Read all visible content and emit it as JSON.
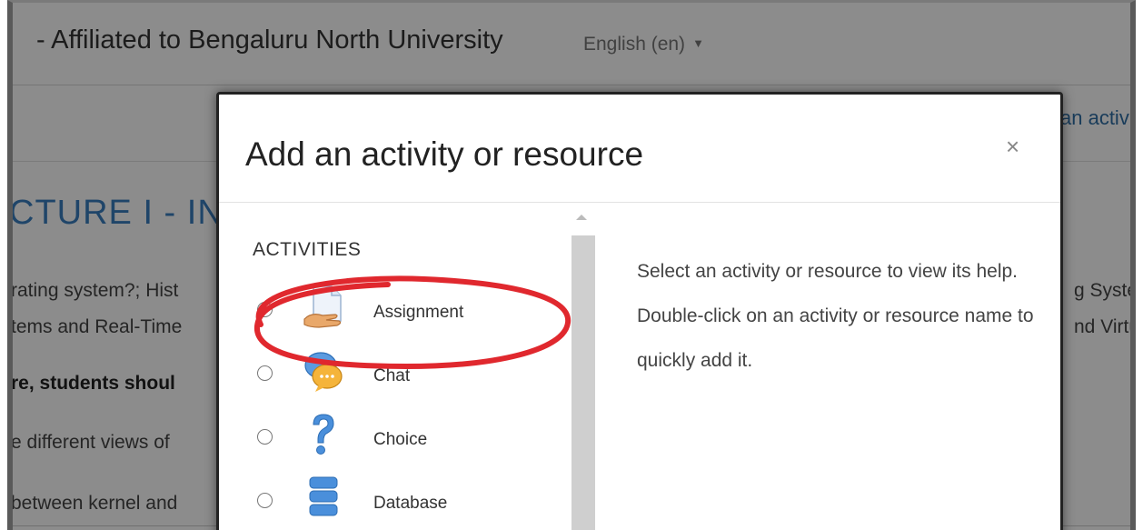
{
  "header": {
    "site_name": "- Affiliated to Bengaluru North University",
    "language": "English (en)"
  },
  "page": {
    "add_activity_link": "an activ",
    "section_title": "CTURE I - IN",
    "lines": [
      "rating system?; Hist",
      "tems and Real-Time",
      "re, students shoul",
      "e different views of",
      "between kernel and"
    ],
    "right_lines": [
      "g Systen",
      "nd Virtua"
    ]
  },
  "modal": {
    "title": "Add an activity or resource",
    "close_glyph": "×",
    "category": "ACTIVITIES",
    "options": [
      {
        "label": "Assignment",
        "icon": "assignment-icon",
        "selected": false
      },
      {
        "label": "Chat",
        "icon": "chat-icon",
        "selected": false
      },
      {
        "label": "Choice",
        "icon": "choice-icon",
        "selected": false
      },
      {
        "label": "Database",
        "icon": "database-icon",
        "selected": false
      }
    ],
    "help_text": "Select an activity or resource to view its help. Double-click on an activity or resource name to quickly add it."
  },
  "colors": {
    "annotation": "#e0282e",
    "link": "#2f6ea5",
    "overlay": "rgba(0,0,0,0.45)"
  }
}
